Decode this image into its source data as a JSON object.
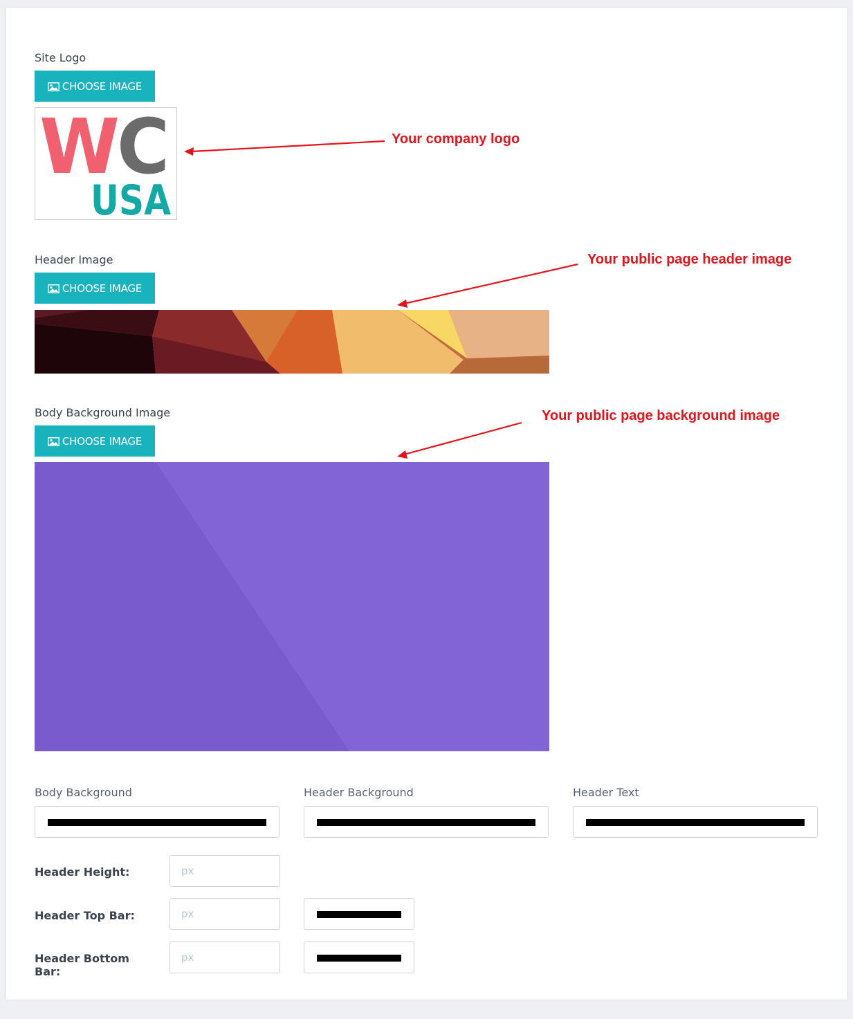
{
  "site_logo": {
    "label": "Site Logo",
    "button_label": "CHOOSE IMAGE",
    "logo_text_top_left": "W",
    "logo_text_top_right": "C",
    "logo_text_bottom": "USA",
    "annotation": "Your company logo"
  },
  "header_image": {
    "label": "Header Image",
    "button_label": "CHOOSE IMAGE",
    "annotation": "Your public page header image"
  },
  "body_background_image": {
    "label": "Body Background Image",
    "button_label": "CHOOSE IMAGE",
    "annotation": "Your public page background image"
  },
  "colors": {
    "body_background_label": "Body Background",
    "body_background_value": "#000000",
    "header_background_label": "Header Background",
    "header_background_value": "#000000",
    "header_text_label": "Header Text",
    "header_text_value": "#000000"
  },
  "dimensions": {
    "header_height_label": "Header Height:",
    "header_height_placeholder": "px",
    "header_top_bar_label": "Header Top Bar:",
    "header_top_bar_placeholder": "px",
    "header_top_bar_color": "#000000",
    "header_bottom_bar_label": "Header Bottom Bar:",
    "header_bottom_bar_placeholder": "px",
    "header_bottom_bar_color": "#000000"
  },
  "theme": {
    "accent": "#19b3be",
    "annotation_color": "#e3151c",
    "logo_w_color": "#f0606f",
    "logo_c_color": "#6b6b6b",
    "logo_usa_color": "#14a9a5",
    "body_image_color": "#8264d6"
  }
}
